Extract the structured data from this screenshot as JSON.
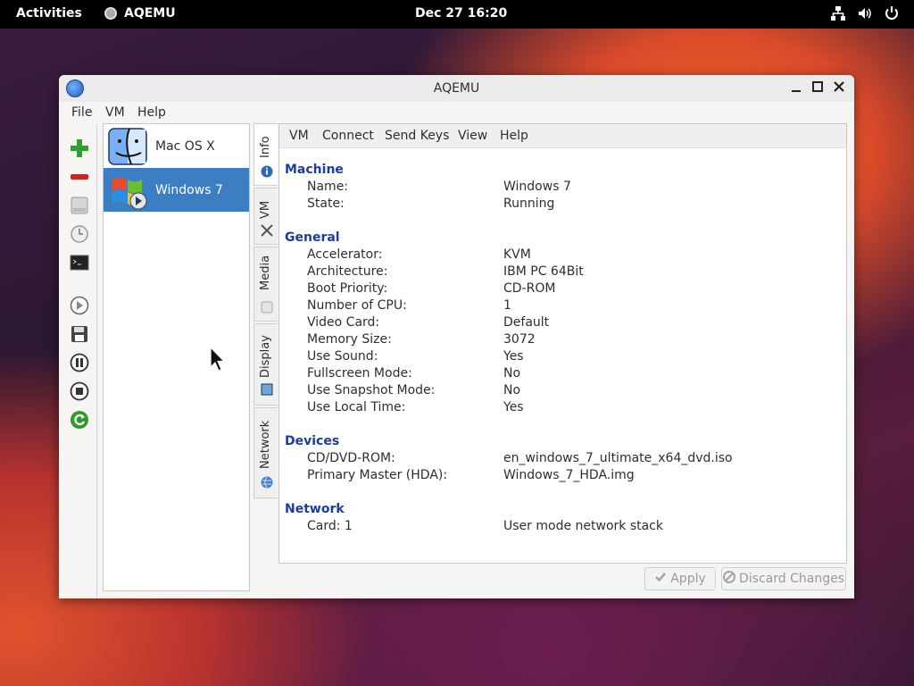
{
  "topbar": {
    "activities": "Activities",
    "app_name": "AQEMU",
    "datetime": "Dec 27  16:20"
  },
  "window": {
    "title": "AQEMU",
    "menu": [
      "File",
      "VM",
      "Help"
    ]
  },
  "toolbar": {
    "icons": [
      "add-vm-icon",
      "remove-vm-icon",
      "hard-disk-icon",
      "clock-icon",
      "terminal-icon",
      "start-icon",
      "save-icon",
      "pause-icon",
      "stop-icon",
      "reset-icon"
    ]
  },
  "vm_list": [
    {
      "label": "Mac OS X",
      "icon": "macos-finder-icon",
      "selected": false
    },
    {
      "label": "Windows 7",
      "icon": "windows-logo-icon",
      "selected": true
    }
  ],
  "side_tabs": [
    {
      "label": "Info",
      "icon": "info-icon"
    },
    {
      "label": "VM",
      "icon": "tools-icon"
    },
    {
      "label": "Media",
      "icon": "disc-icon"
    },
    {
      "label": "Display",
      "icon": "monitor-icon"
    },
    {
      "label": "Network",
      "icon": "globe-icon"
    }
  ],
  "panel_menu": [
    "VM",
    "Connect",
    "Send Keys",
    "View",
    "Help"
  ],
  "info": {
    "machine": {
      "heading": "Machine",
      "rows": [
        {
          "label": "Name:",
          "value": "Windows 7"
        },
        {
          "label": "State:",
          "value": "Running"
        }
      ]
    },
    "general": {
      "heading": "General",
      "rows": [
        {
          "label": "Accelerator:",
          "value": "KVM"
        },
        {
          "label": "Architecture:",
          "value": "IBM PC 64Bit"
        },
        {
          "label": "Boot Priority:",
          "value": "CD-ROM"
        },
        {
          "label": "Number of CPU:",
          "value": "1"
        },
        {
          "label": "Video Card:",
          "value": "Default"
        },
        {
          "label": "Memory Size:",
          "value": "3072"
        },
        {
          "label": "Use Sound:",
          "value": "Yes"
        },
        {
          "label": "Fullscreen Mode:",
          "value": "No"
        },
        {
          "label": "Use Snapshot Mode:",
          "value": "No"
        },
        {
          "label": "Use Local Time:",
          "value": "Yes"
        }
      ]
    },
    "devices": {
      "heading": "Devices",
      "rows": [
        {
          "label": "CD/DVD-ROM:",
          "value": "en_windows_7_ultimate_x64_dvd.iso"
        },
        {
          "label": "Primary Master (HDA):",
          "value": "Windows_7_HDA.img"
        }
      ]
    },
    "network": {
      "heading": "Network",
      "rows": [
        {
          "label": "Card: 1",
          "value": "User mode network stack"
        }
      ]
    }
  },
  "buttons": {
    "apply": "Apply",
    "discard": "Discard Changes"
  },
  "colors": {
    "accent": "#3c7ec4",
    "section_heading": "#1a3e9e",
    "topbar": "#000000"
  }
}
